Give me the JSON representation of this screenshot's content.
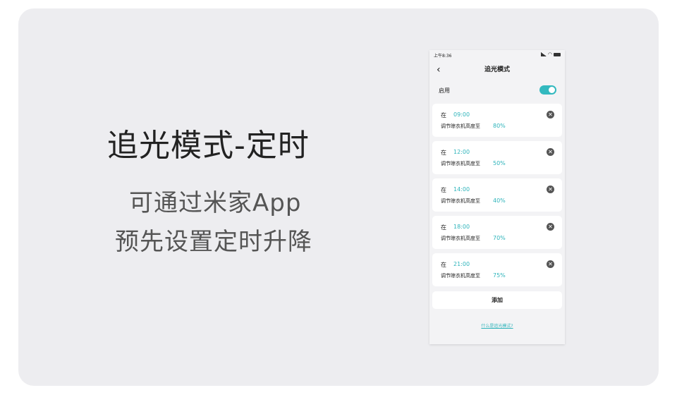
{
  "hero": {
    "title": "追光模式-定时",
    "line1": "可通过米家App",
    "line2": "预先设置定时升降"
  },
  "phone": {
    "status_time": "上午8:36",
    "nav_title": "追光模式",
    "enable_label": "启用",
    "enabled": true,
    "schedules": [
      {
        "at": "在",
        "time": "09:00",
        "desc": "调节晾衣机高度至",
        "pct": "80%"
      },
      {
        "at": "在",
        "time": "12:00",
        "desc": "调节晾衣机高度至",
        "pct": "50%"
      },
      {
        "at": "在",
        "time": "14:00",
        "desc": "调节晾衣机高度至",
        "pct": "40%"
      },
      {
        "at": "在",
        "time": "18:00",
        "desc": "调节晾衣机高度至",
        "pct": "70%"
      },
      {
        "at": "在",
        "time": "21:00",
        "desc": "调节晾衣机高度至",
        "pct": "75%"
      }
    ],
    "add_label": "添加",
    "help_link": "什么是追光模式?"
  },
  "colors": {
    "accent": "#2fb4bb",
    "toggle": "#33b9bf",
    "background": "#ededf0"
  },
  "icons": {
    "back": "chevron-left-icon",
    "remove": "close-circle-icon"
  }
}
